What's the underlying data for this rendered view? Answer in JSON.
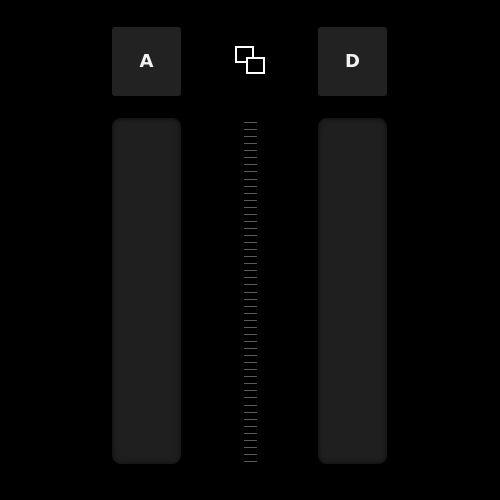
{
  "decks": {
    "left": {
      "label": "A"
    },
    "right": {
      "label": "D"
    }
  },
  "link": {
    "icon": "link-squares-icon"
  },
  "scale": {
    "tick_count": 49
  },
  "colors": {
    "background": "#000000",
    "button": "#222222",
    "track": "#1f1f1f",
    "text": "#f2f2f2",
    "tick": "#5a5a5a",
    "icon_stroke": "#ffffff"
  }
}
